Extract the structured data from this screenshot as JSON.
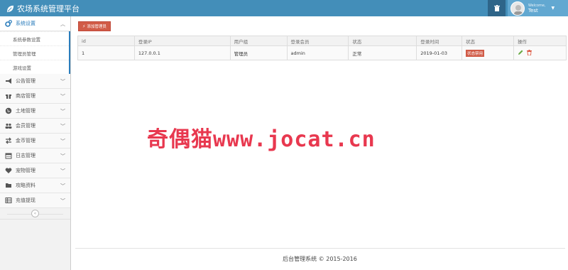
{
  "app": {
    "title": "农场系统管理平台"
  },
  "user": {
    "welcome": "Welcome,",
    "name": "Test"
  },
  "colors": {
    "header": "#438eb9",
    "accent": "#2b7dbc",
    "danger": "#d15b47",
    "edit": "#69aa46"
  },
  "sidebar": {
    "active": {
      "icon": "cogs-icon",
      "label": "系统设置"
    },
    "submenu": [
      "系统参数设置",
      "管理员管理",
      "游戏设置"
    ],
    "items": [
      {
        "icon": "bullhorn-icon",
        "label": "公告管理"
      },
      {
        "icon": "gift-icon",
        "label": "商店管理"
      },
      {
        "icon": "globe-icon",
        "label": "土地管理"
      },
      {
        "icon": "users-icon",
        "label": "会员管理"
      },
      {
        "icon": "exchange-icon",
        "label": "金币管理"
      },
      {
        "icon": "calendar-icon",
        "label": "日志管理"
      },
      {
        "icon": "heart-icon",
        "label": "宠物管理"
      },
      {
        "icon": "folder-icon",
        "label": "攻略资料"
      },
      {
        "icon": "list-icon",
        "label": "充值提现"
      }
    ]
  },
  "toolbar": {
    "add_label": "添加管理员"
  },
  "table": {
    "headers": [
      "id",
      "登录IP",
      "用户组",
      "登录会员",
      "状态",
      "登录时间",
      "状态",
      "操作"
    ],
    "rows": [
      {
        "id": "1",
        "ip": "127.0.0.1",
        "group": "管理员",
        "member": "admin",
        "status": "正常",
        "time": "2019-01-03",
        "badge": "状态禁用"
      }
    ]
  },
  "watermark": "奇偶猫www.jocat.cn",
  "footer": "后台管理系统 © 2015-2016"
}
